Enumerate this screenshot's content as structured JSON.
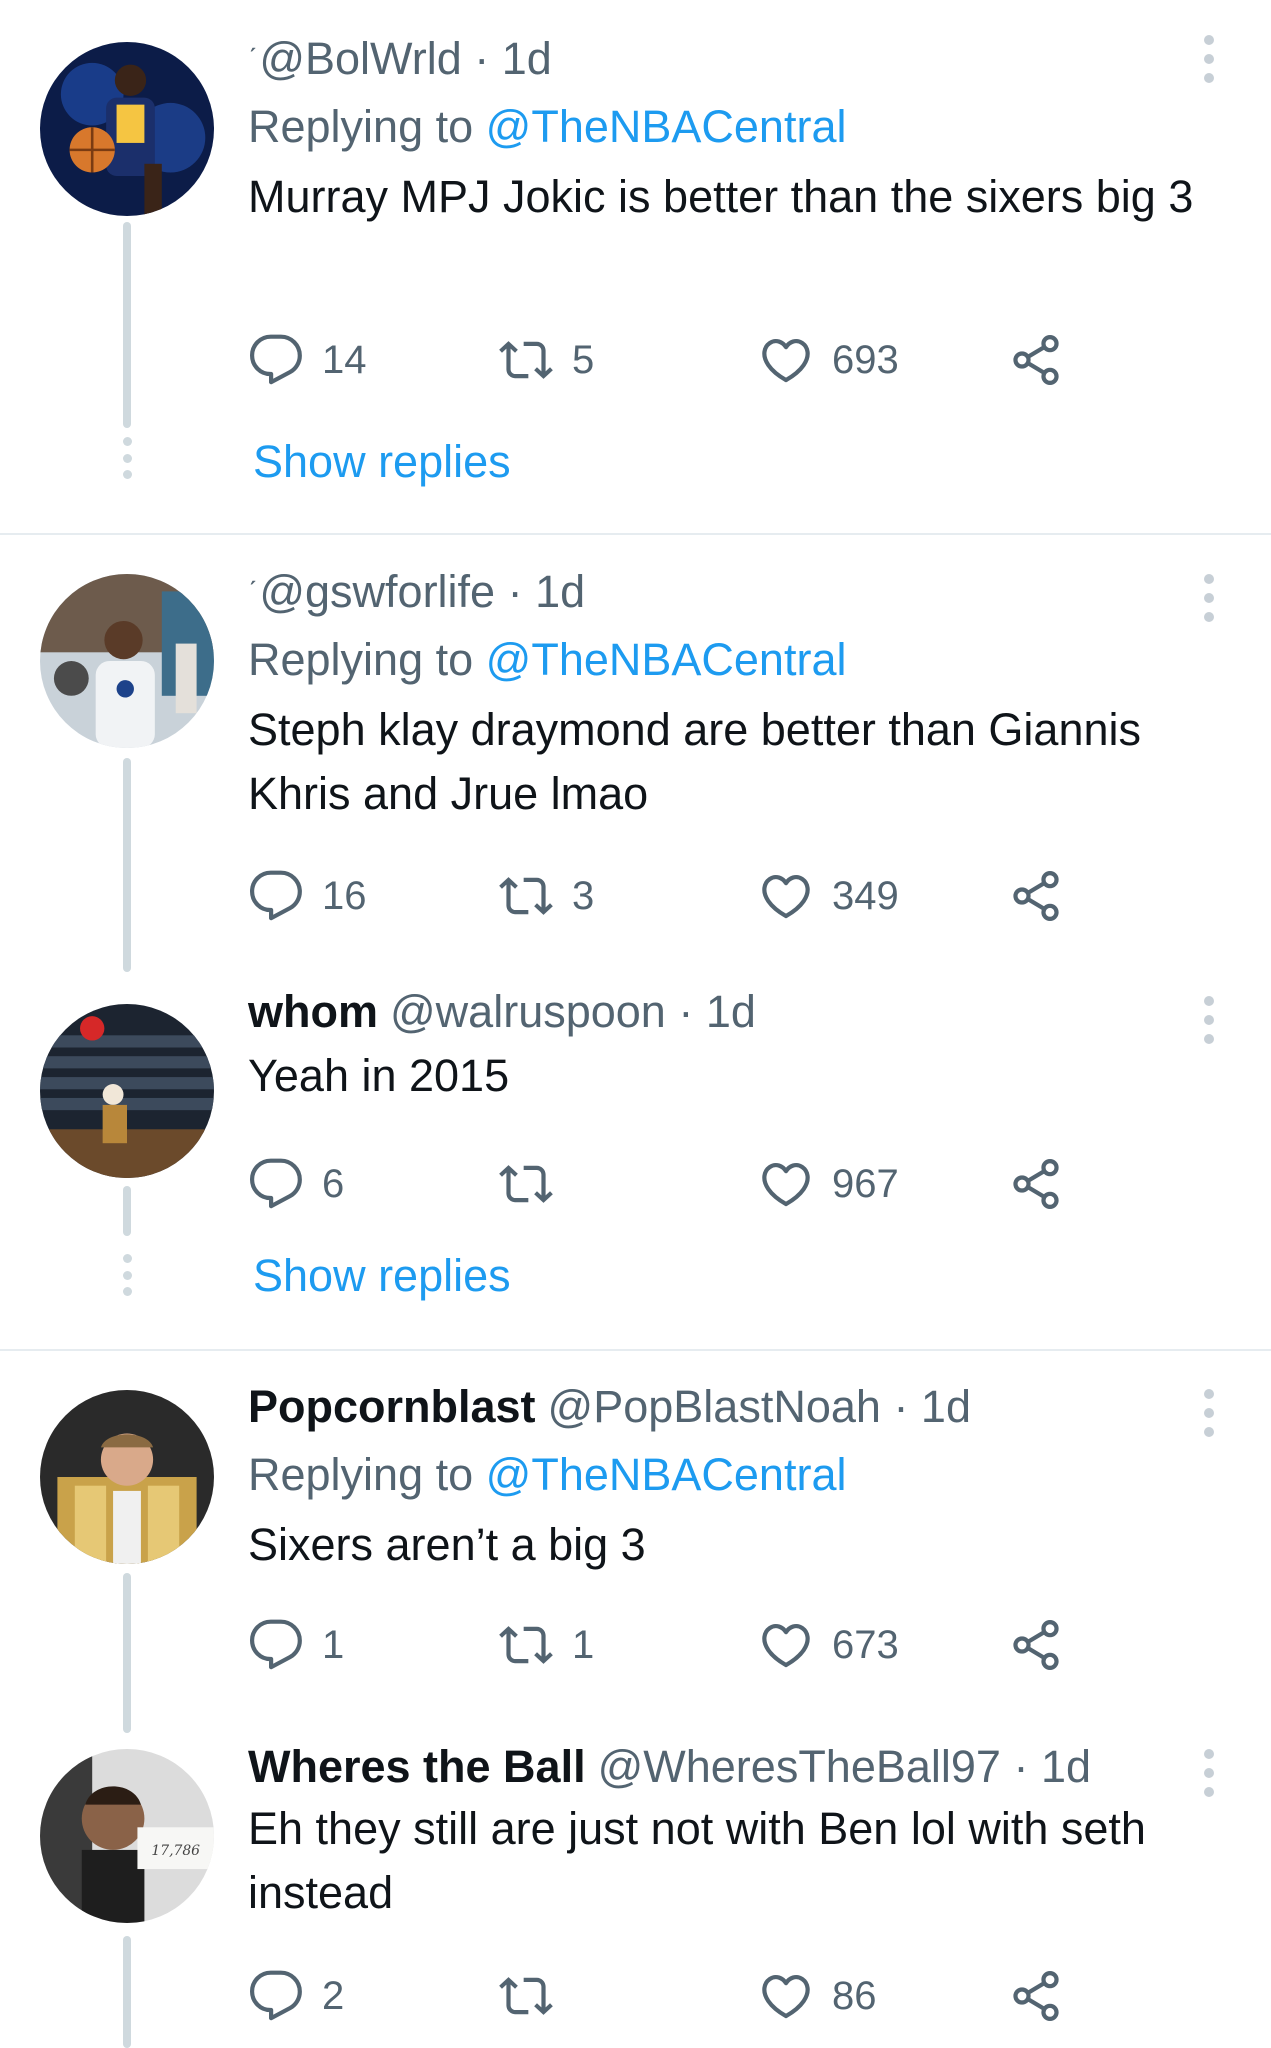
{
  "colors": {
    "link": "#1d9bf0",
    "secondary": "#536471",
    "text": "#0f1419",
    "line": "#cfd9de"
  },
  "icons": {
    "reply": "speech-bubble-icon",
    "retweet": "retweet-arrows-icon",
    "like": "heart-icon",
    "share": "share-nodes-icon",
    "more": "vertical-dots-icon"
  },
  "tweets": [
    {
      "name": "",
      "handle": "@BolWrld",
      "time": "· 1d",
      "replying_label": "Replying to",
      "replying_to": "@TheNBACentral",
      "text": "Murray MPJ Jokic is better than the sixers big 3",
      "replies": "14",
      "retweets": "5",
      "likes": "693",
      "show_replies": "Show replies"
    },
    {
      "name": "",
      "handle": "@gswforlife",
      "time": "· 1d",
      "replying_label": "Replying to",
      "replying_to": "@TheNBACentral",
      "text": "Steph klay draymond are better than Giannis Khris and Jrue lmao",
      "replies": "16",
      "retweets": "3",
      "likes": "349"
    },
    {
      "name": "whom",
      "handle": "@walruspoon",
      "time": "· 1d",
      "text": "Yeah in 2015",
      "replies": "6",
      "retweets": "",
      "likes": "967",
      "show_replies": "Show replies"
    },
    {
      "name": "Popcornblast",
      "handle": "@PopBlastNoah",
      "time": "· 1d",
      "replying_label": "Replying to",
      "replying_to": "@TheNBACentral",
      "text": "Sixers aren’t a big 3",
      "replies": "1",
      "retweets": "1",
      "likes": "673"
    },
    {
      "name": "Wheres the Ball",
      "handle": "@WheresTheBall97",
      "time": "· 1d",
      "text": "Eh they still are just not with Ben lol with seth instead",
      "replies": "2",
      "retweets": "",
      "likes": "86",
      "avatar_sign": "17,786"
    }
  ]
}
